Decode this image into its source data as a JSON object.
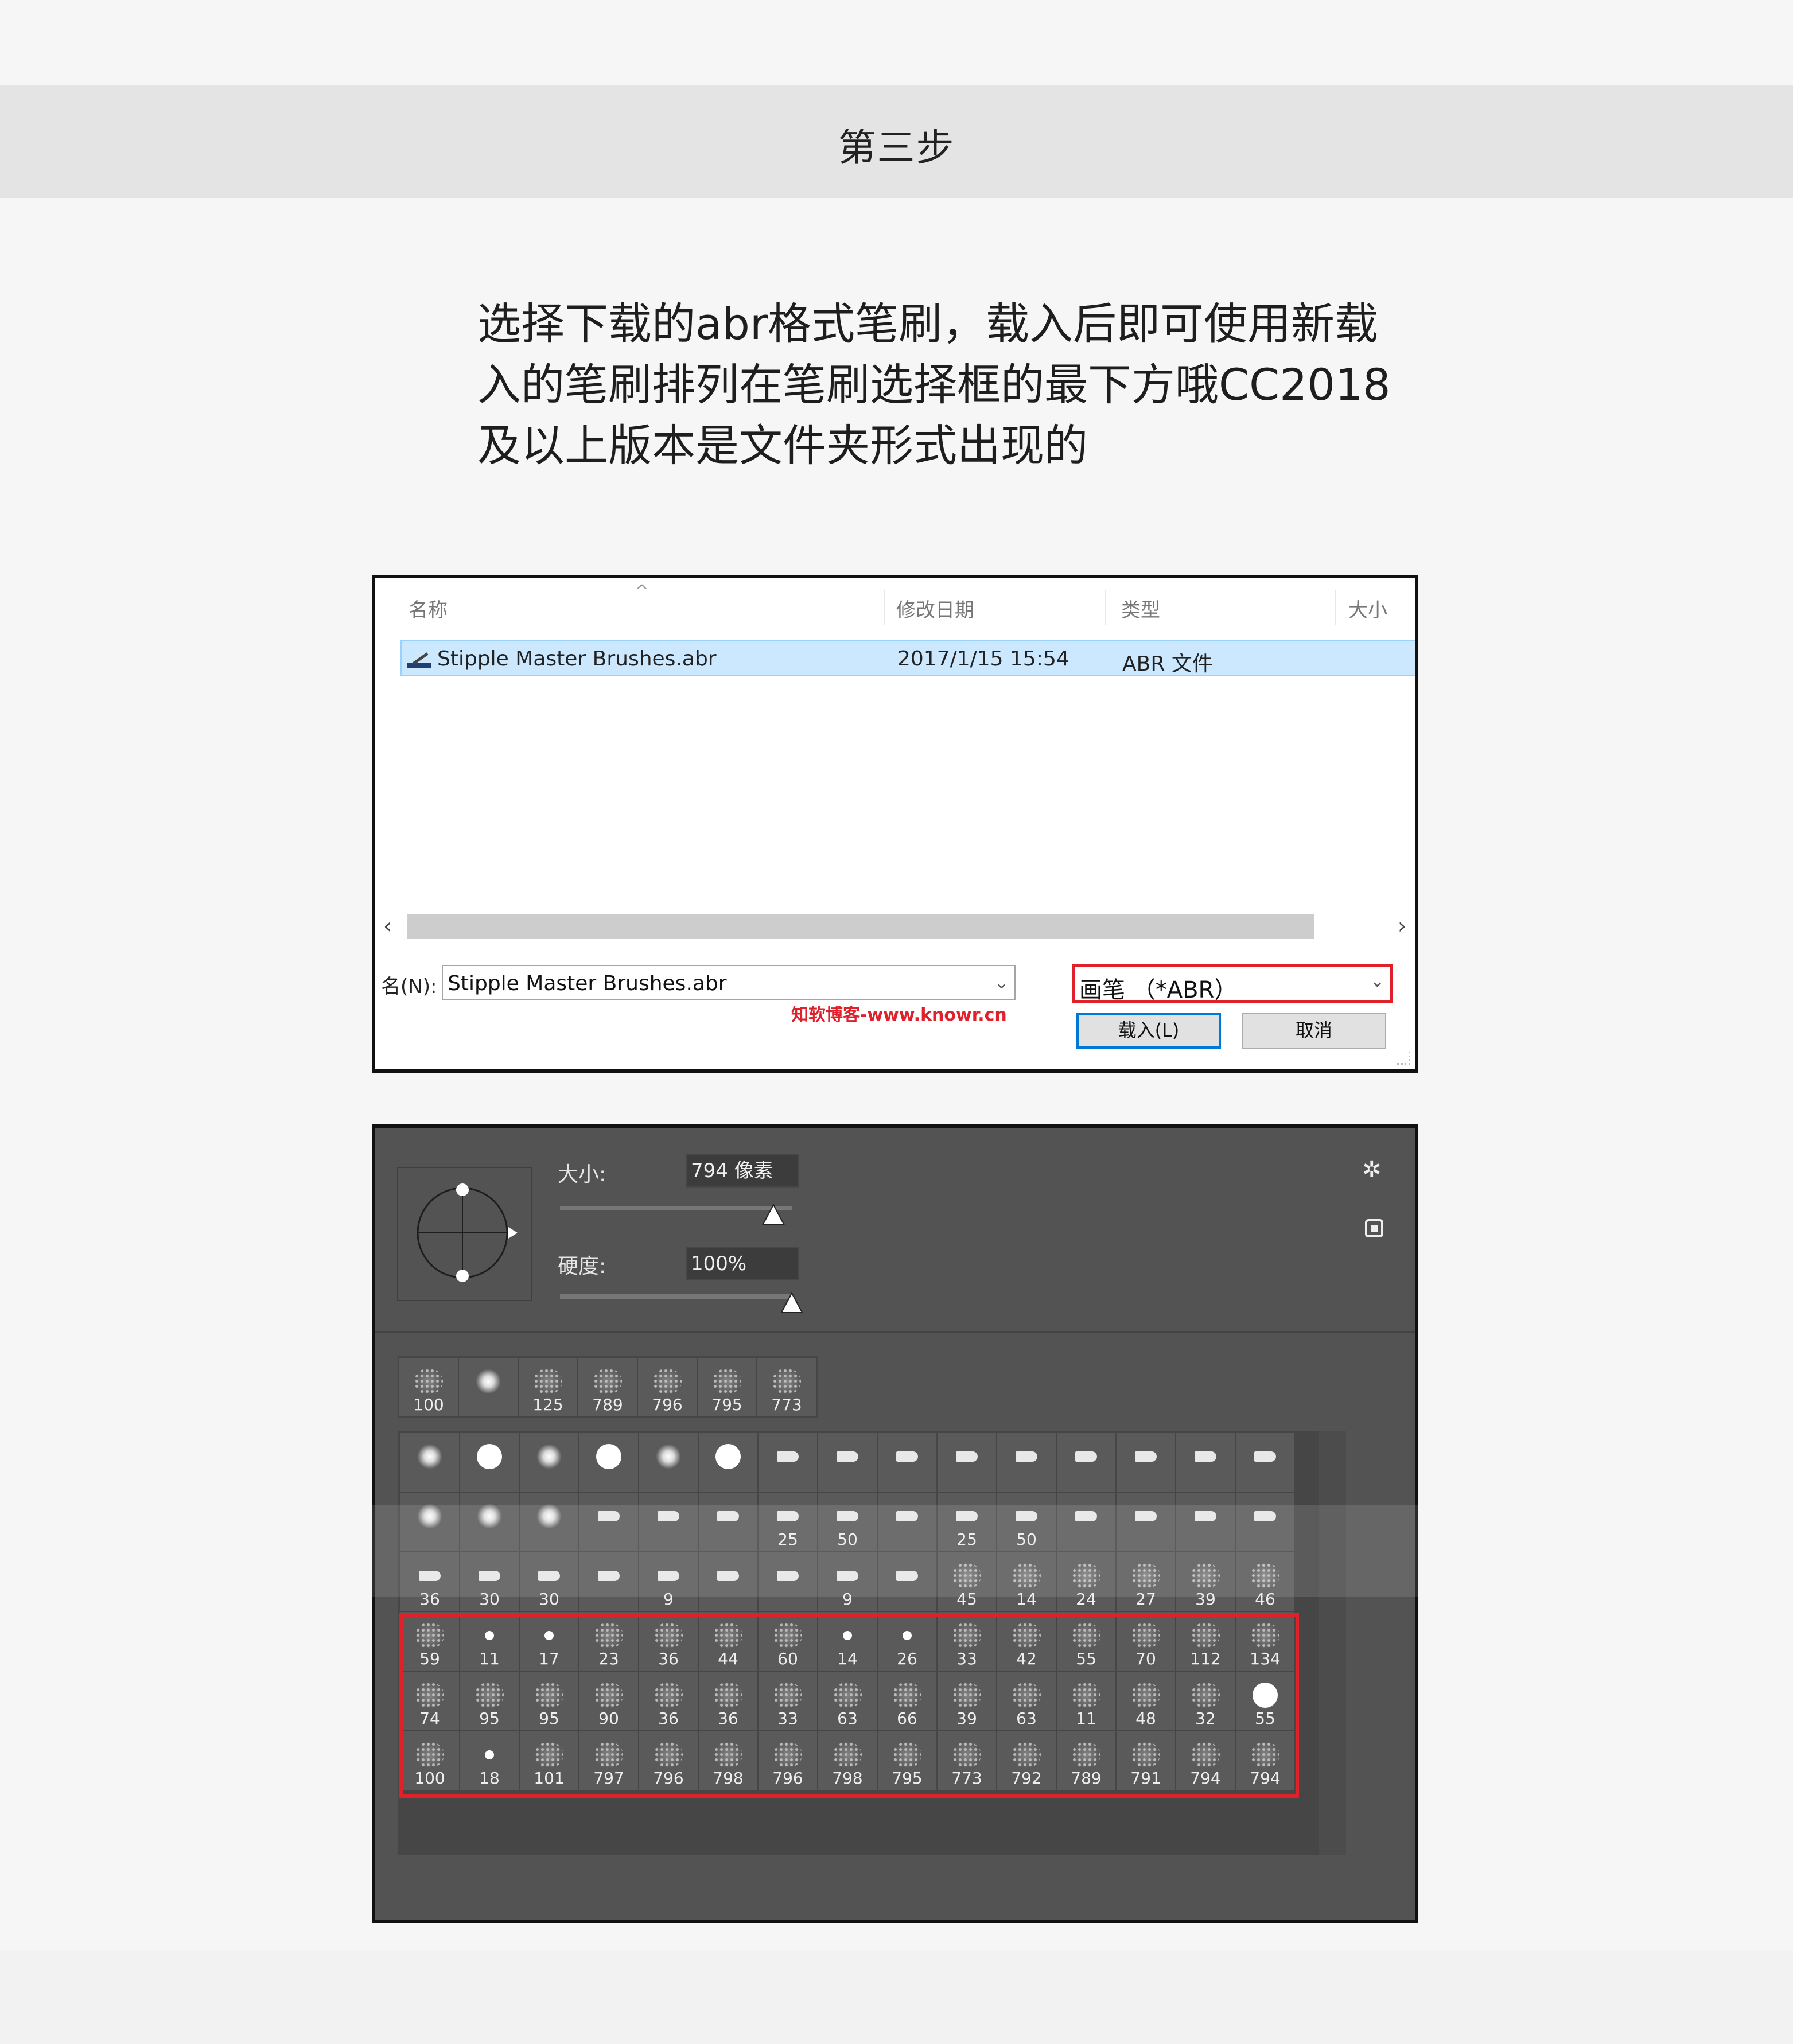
{
  "header": {
    "title": "第三步"
  },
  "instructions": {
    "line1": "选择下载的abr格式笔刷，载入后即可使用新载",
    "line2": "入的笔刷排列在笔刷选择框的最下方哦CC2018",
    "line3": "及以上版本是文件夹形式出现的"
  },
  "file_dialog": {
    "columns": {
      "name": "名称",
      "date": "修改日期",
      "type": "类型",
      "size": "大小"
    },
    "selected_file": {
      "name": "Stipple Master Brushes.abr",
      "date": "2017/1/15 15:54",
      "type": "ABR 文件"
    },
    "filename_label": "名(N):",
    "filename_value": "Stipple Master Brushes.abr",
    "filetype_value": "画笔 （*ABR）",
    "watermark": "知软博客-www.knowr.cn",
    "load_button": "载入(L)",
    "cancel_button": "取消"
  },
  "brush_panel": {
    "size_label": "大小:",
    "size_value": "794 像素",
    "size_slider_fraction": 0.92,
    "hardness_label": "硬度:",
    "hardness_value": "100%",
    "hardness_slider_fraction": 1.0,
    "icons": [
      "gear-icon",
      "new-preset-icon"
    ],
    "recent_brushes": [
      "100",
      "",
      "125",
      "789",
      "796",
      "795",
      "773"
    ],
    "library_rows": [
      [
        "",
        "",
        "",
        "",
        "",
        "",
        "",
        "",
        "",
        "",
        "",
        "",
        "",
        "",
        ""
      ],
      [
        "",
        "",
        "",
        "",
        "",
        "",
        "25",
        "50",
        "",
        "25",
        "50",
        "",
        "",
        "",
        ""
      ],
      [
        "36",
        "30",
        "30",
        "",
        "9",
        "",
        "",
        "9",
        "",
        "45",
        "14",
        "24",
        "27",
        "39",
        "46"
      ],
      [
        "59",
        "11",
        "17",
        "23",
        "36",
        "44",
        "60",
        "14",
        "26",
        "33",
        "42",
        "55",
        "70",
        "112",
        "134"
      ],
      [
        "74",
        "95",
        "95",
        "90",
        "36",
        "36",
        "33",
        "63",
        "66",
        "39",
        "63",
        "11",
        "48",
        "32",
        "55"
      ],
      [
        "100",
        "18",
        "101",
        "797",
        "796",
        "798",
        "796",
        "798",
        "795",
        "773",
        "792",
        "789",
        "791",
        "794",
        "794"
      ]
    ],
    "highlight_color": "#e0202a"
  }
}
